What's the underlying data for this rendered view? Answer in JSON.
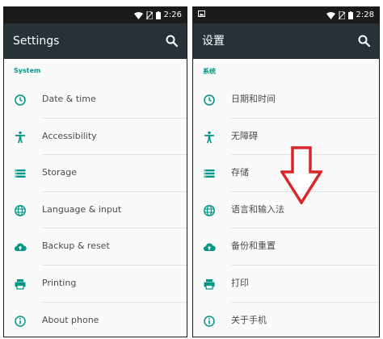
{
  "colors": {
    "accent": "#009688",
    "toolbar": "#263238",
    "statusbar": "#1b1b1b",
    "arrow": "#d9252b"
  },
  "left": {
    "status": {
      "time": "2:26"
    },
    "title": "Settings",
    "section": "System",
    "items": [
      {
        "label": "Date & time",
        "icon": "clock-icon"
      },
      {
        "label": "Accessibility",
        "icon": "accessibility-icon"
      },
      {
        "label": "Storage",
        "icon": "storage-icon"
      },
      {
        "label": "Language & input",
        "icon": "globe-icon"
      },
      {
        "label": "Backup & reset",
        "icon": "cloud-upload-icon"
      },
      {
        "label": "Printing",
        "icon": "printer-icon"
      },
      {
        "label": "About phone",
        "icon": "info-icon"
      }
    ]
  },
  "right": {
    "status": {
      "time": "2:28"
    },
    "title": "设置",
    "section": "系统",
    "items": [
      {
        "label": "日期和时间",
        "icon": "clock-icon"
      },
      {
        "label": "无障碍",
        "icon": "accessibility-icon"
      },
      {
        "label": "存储",
        "icon": "storage-icon"
      },
      {
        "label": "语言和输入法",
        "icon": "globe-icon"
      },
      {
        "label": "备份和重置",
        "icon": "cloud-upload-icon"
      },
      {
        "label": "打印",
        "icon": "printer-icon"
      },
      {
        "label": "关于手机",
        "icon": "info-icon"
      }
    ]
  }
}
